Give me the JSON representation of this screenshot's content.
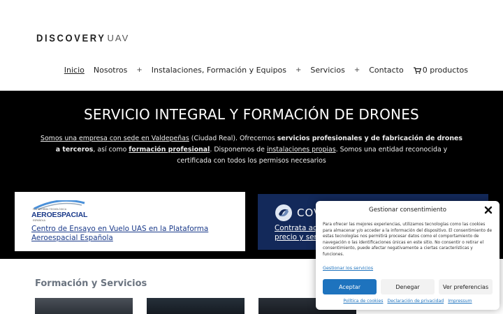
{
  "header": {
    "logo_part1": "DISCOVERY",
    "logo_part2": "UAV",
    "nav": [
      {
        "label": "Inicio"
      },
      {
        "label": "Nosotros"
      },
      {
        "label": "Instalaciones, Formación y Equipos"
      },
      {
        "label": "Servicios"
      },
      {
        "label": "Contacto"
      }
    ],
    "cart_label": "0 productos",
    "plus": "+"
  },
  "hero": {
    "title": "SERVICIO INTEGRAL Y FORMACIÓN DE DRONES",
    "p1": "Somos una empresa con sede en Valdepeñas",
    "p2": " (Ciudad Real). Ofrecemos ",
    "p3": "servicios profesionales y de fabricación de drones a terceros",
    "p4": ", así como ",
    "p5": "formación profesional",
    "p6": ". Disponemos de ",
    "p7": "instalaciones propias",
    "p8": ". Somos una entidad reconocida y certificada con todos los permisos necesarios"
  },
  "cards": {
    "card1": {
      "logo_small": "PLATAFORMA TECNOLÓGICA",
      "logo_main": "AEROESPACIAL",
      "logo_sub": "ESPAÑOLA",
      "link": "Centro de Ensayo en Vuelo UAS en la Plataforma Aeroespacial Española"
    },
    "card2": {
      "logo": "COV",
      "link_line1": "Contrata aq",
      "link_line2": "precio y ser"
    }
  },
  "section": {
    "title": "Formación y Servicios"
  },
  "consent": {
    "title": "Gestionar consentimiento",
    "body": "Para ofrecer las mejores experiencias, utilizamos tecnologías como las cookies para almacenar y/o acceder a la información del dispositivo. El consentimiento de estas tecnologías nos permitirá procesar datos como el comportamiento de navegación o las identificaciones únicas en este sitio. No consentir o retirar el consentimiento, puede afectar negativamente a ciertas características y funciones.",
    "manage_link": "Gestionar los servicios",
    "accept": "Aceptar",
    "deny": "Denegar",
    "prefs": "Ver preferencias",
    "links": [
      "Política de cookies",
      "Declaración de privacidad",
      "Impressum"
    ]
  },
  "colors": {
    "accent": "#1e73be",
    "hero_bg": "#000000",
    "card2_bg": "#13295a",
    "link": "#1a3a8a"
  }
}
